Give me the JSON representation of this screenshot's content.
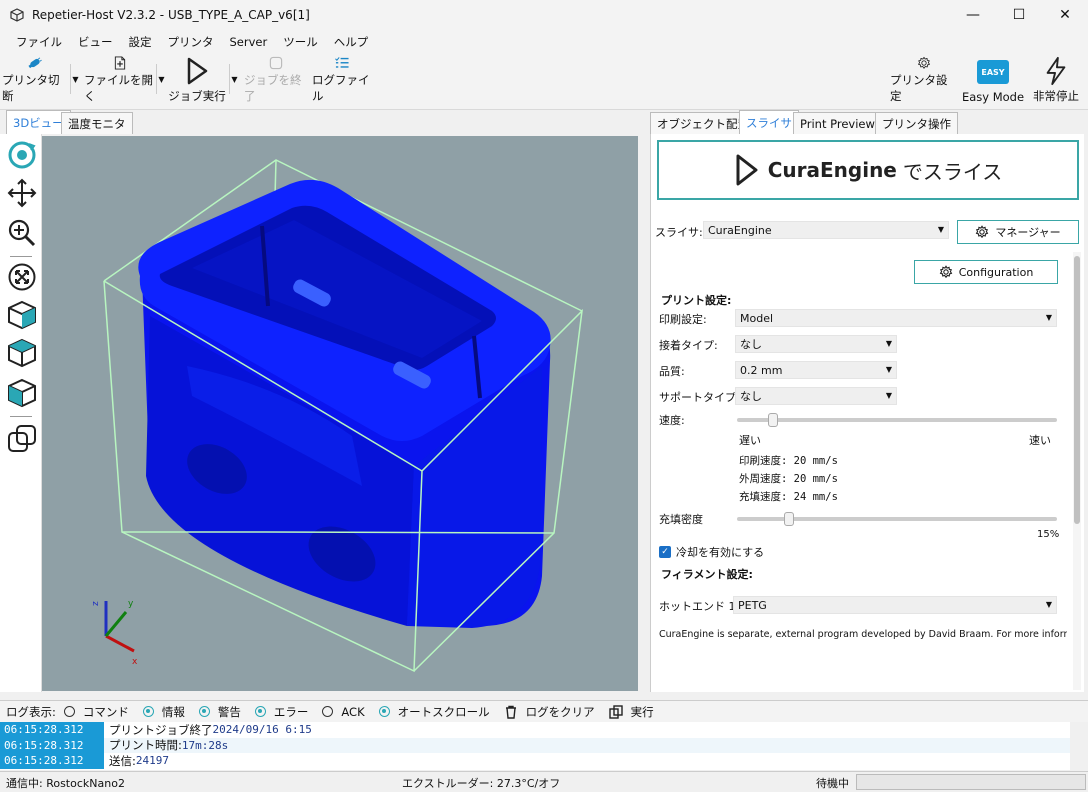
{
  "window": {
    "title": "Repetier-Host V2.3.2 - USB_TYPE_A_CAP_v6[1]",
    "min": "—",
    "max": "☐",
    "close": "✕"
  },
  "menu": [
    "ファイル",
    "ビュー",
    "設定",
    "プリンタ",
    "Server",
    "ツール",
    "ヘルプ"
  ],
  "toolbar": {
    "disconnect": "プリンタ切断",
    "open_file": "ファイルを開く",
    "run_job": "ジョブ実行",
    "end_job": "ジョブを終了",
    "log_file": "ログファイル",
    "printer_settings": "プリンタ設定",
    "easy_mode": "Easy Mode",
    "easy_badge": "EASY",
    "emergency_stop": "非常停止"
  },
  "left_tabs": [
    "3Dビュー",
    "温度モニタ"
  ],
  "right_tabs": [
    "オブジェクト配置",
    "スライサ",
    "Print Preview",
    "プリンタ操作"
  ],
  "slicer": {
    "slice_button_engine": "CuraEngine",
    "slice_button_suffix": "でスライス",
    "slicer_label": "スライサ:",
    "slicer_value": "CuraEngine",
    "manager_button": "マネージャー",
    "configuration_button": "Configuration",
    "print_settings_header": "プリント設定:",
    "profile_label": "印刷設定:",
    "profile_value": "Model",
    "adhesion_label": "接着タイプ:",
    "adhesion_value": "なし",
    "quality_label": "品質:",
    "quality_value": "0.2 mm",
    "support_label": "サポートタイプ:",
    "support_value": "なし",
    "speed_label": "速度:",
    "speed_slow": "遅い",
    "speed_fast": "速い",
    "speed_level": 0.1,
    "print_speed": "印刷速度:  20 mm/s",
    "perimeter_speed": "外周速度:  20 mm/s",
    "infill_speed": "充填速度:  24 mm/s",
    "infill_label": "充填密度",
    "infill_value": "15%",
    "infill_level": 0.15,
    "cooling_label": "冷却を有効にする",
    "filament_header": "フィラメント設定:",
    "hotend_label": "ホットエンド 1:",
    "hotend_value": "PETG",
    "note": "CuraEngine is separate, external program developed by David Braam. For more informa"
  },
  "log": {
    "label": "ログ表示:",
    "options": [
      {
        "label": "コマンド",
        "on": false
      },
      {
        "label": "情報",
        "on": true
      },
      {
        "label": "警告",
        "on": true
      },
      {
        "label": "エラー",
        "on": true
      },
      {
        "label": "ACK",
        "on": false
      },
      {
        "label": "オートスクロール",
        "on": true
      }
    ],
    "clear": "ログをクリア",
    "run": "実行",
    "rows": [
      {
        "time": "06:15:28.312",
        "msg": "プリントジョブ終了 ",
        "val": "2024/09/16 6:15"
      },
      {
        "time": "06:15:28.312",
        "msg": "プリント時間:",
        "val": "17m:28s"
      },
      {
        "time": "06:15:28.312",
        "msg": "送信:",
        "val": "24197"
      }
    ]
  },
  "status": {
    "connection": "通信中: RostockNano2",
    "extruder": "エクストルーダー: 27.3°C/オフ",
    "state": "待機中"
  },
  "colors": {
    "accent": "#2aa7b5",
    "model": "#0a14f0",
    "viewport_bg": "#8fa0a6",
    "bbox": "#b8f5c0"
  }
}
